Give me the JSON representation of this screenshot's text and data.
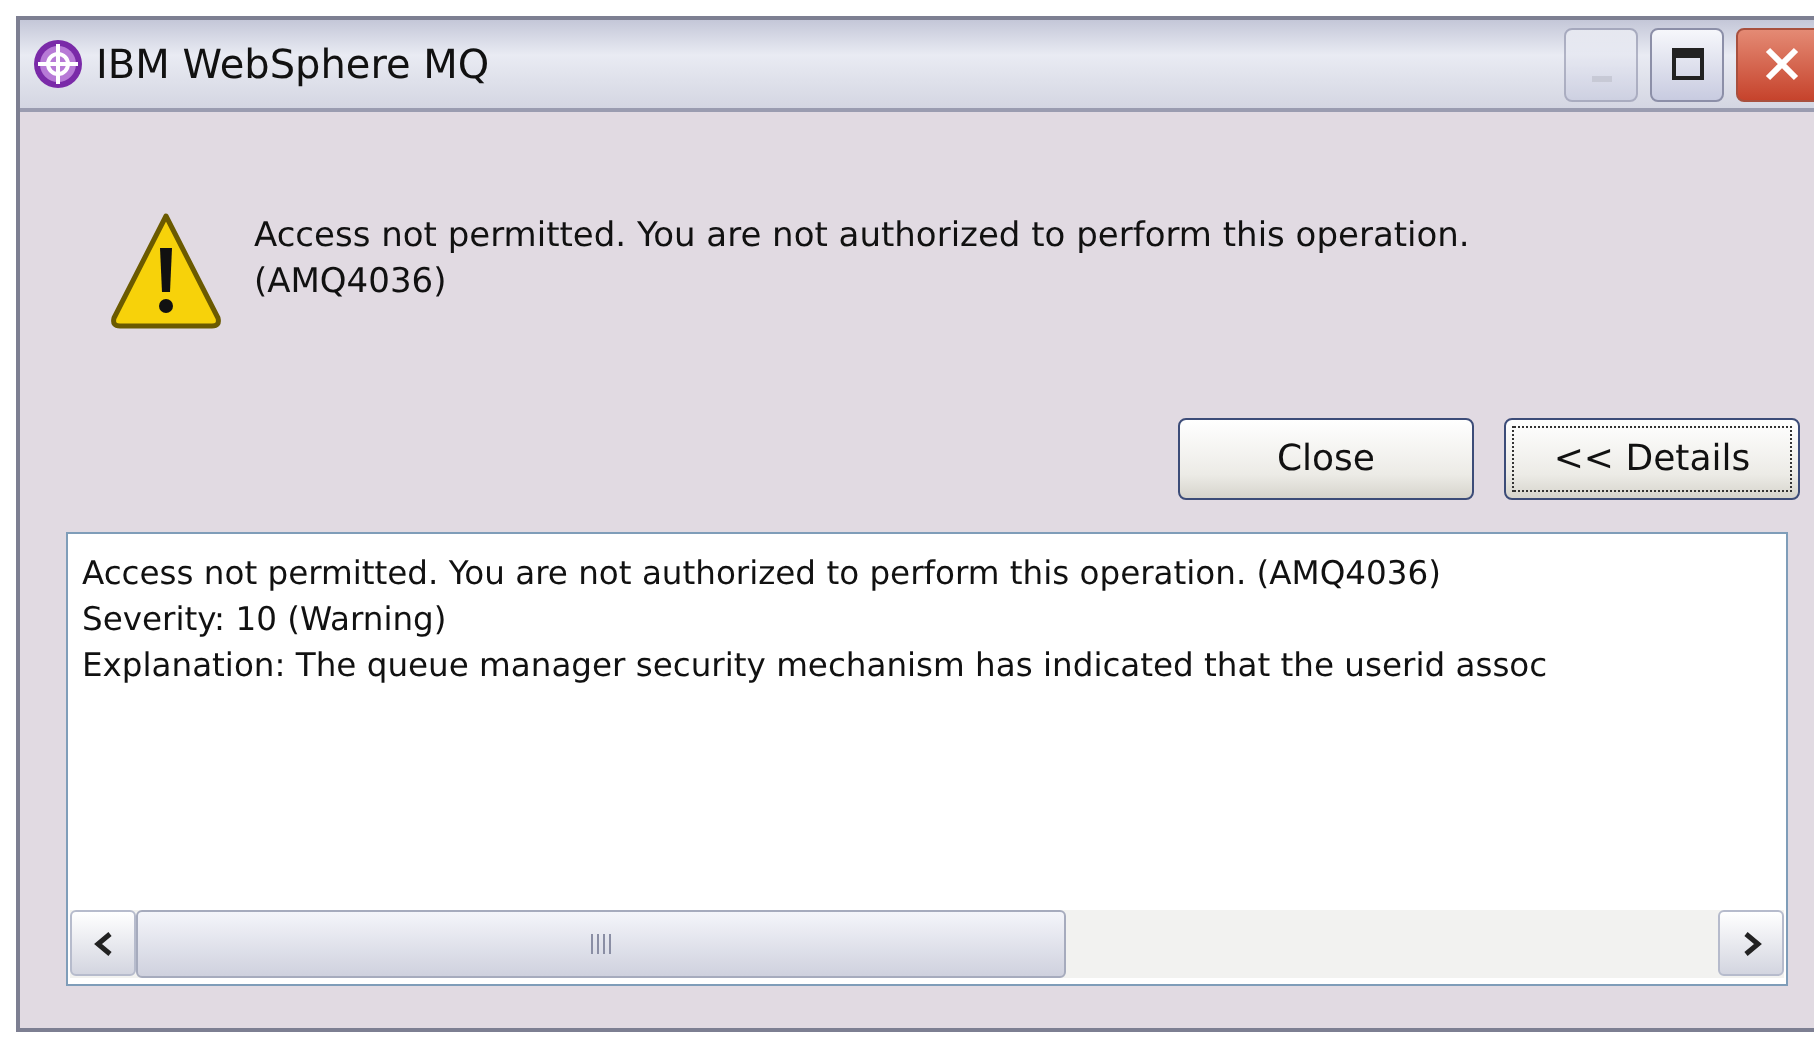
{
  "window": {
    "title": "IBM WebSphere MQ",
    "controls": [
      {
        "kind": "minimize",
        "disabled": true
      },
      {
        "kind": "maximize",
        "disabled": false
      },
      {
        "kind": "close",
        "disabled": false
      }
    ]
  },
  "message": {
    "lines": [
      "Access not permitted. You are not authorized to perform this operation.",
      "(AMQ4036)"
    ]
  },
  "buttons": [
    {
      "label": "Close",
      "focused": false
    },
    {
      "label": "<< Details",
      "focused": true
    }
  ],
  "details": {
    "lines": [
      "Access not permitted. You are not authorized to perform this operation. (AMQ4036)",
      "Severity: 10 (Warning)",
      "Explanation: The queue manager security mechanism has indicated that the userid assoc"
    ]
  }
}
